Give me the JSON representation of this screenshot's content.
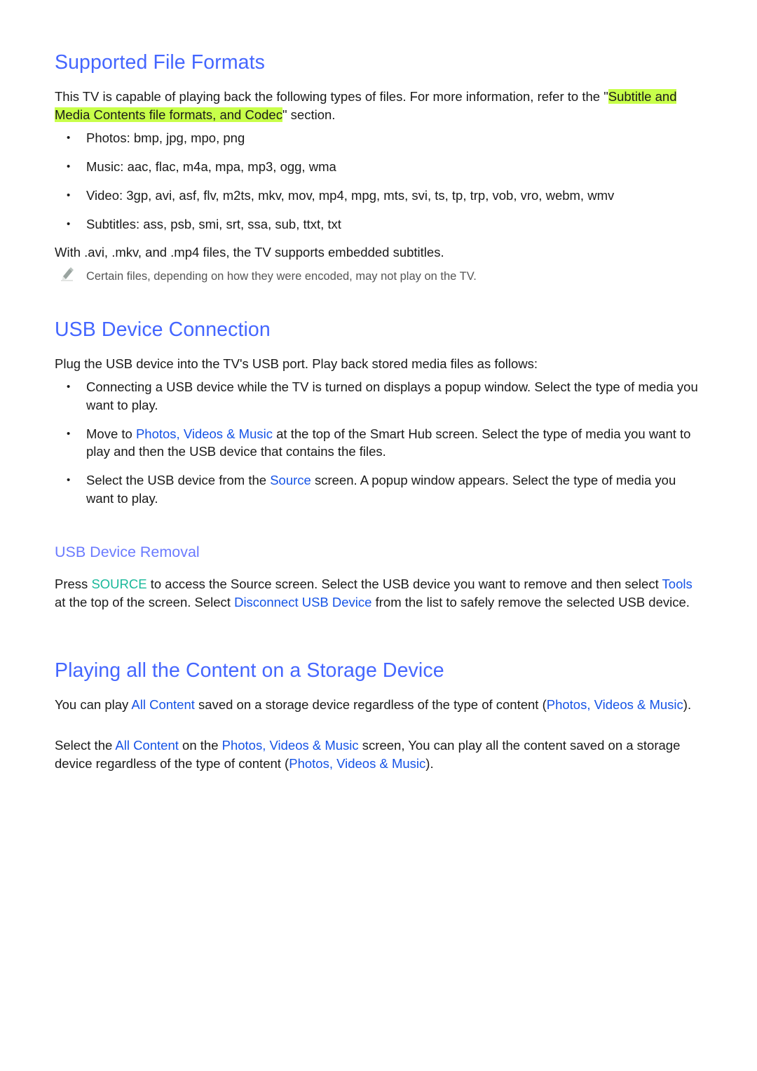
{
  "section1": {
    "title": "Supported File Formats",
    "intro_before": "This TV is capable of playing back the following types of files. For more information, refer to the \"",
    "intro_highlight": "Subtitle and Media Contents file formats, and Codec",
    "intro_after": "\" section.",
    "bullets": [
      "Photos: bmp, jpg, mpo, png",
      "Music: aac, flac, m4a, mpa, mp3, ogg, wma",
      "Video: 3gp, avi, asf, flv, m2ts, mkv, mov, mp4, mpg, mts, svi, ts, tp, trp, vob, vro, webm, wmv",
      "Subtitles: ass, psb, smi, srt, ssa, sub, ttxt, txt"
    ],
    "embedded": "With .avi, .mkv, and .mp4 files, the TV supports embedded subtitles.",
    "note_icon": "pencil-icon",
    "note": "Certain files, depending on how they were encoded, may not play on the TV."
  },
  "section2": {
    "title": "USB Device Connection",
    "intro": "Plug the USB device into the TV's USB port. Play back stored media files as follows:",
    "bullet1": "Connecting a USB device while the TV is turned on displays a popup window. Select the type of media you want to play.",
    "bullet2_before": "Move to ",
    "bullet2_link": "Photos, Videos & Music",
    "bullet2_after": " at the top of the Smart Hub screen. Select the type of media you want to play and then the USB device that contains the files.",
    "bullet3_before": "Select the USB device from the ",
    "bullet3_link": "Source",
    "bullet3_after": " screen. A popup window appears. Select the type of media you want to play."
  },
  "subsection": {
    "title": "USB Device Removal",
    "t1": "Press ",
    "source_key": "SOURCE",
    "t2": " to access the Source screen. Select the USB device you want to remove and then select ",
    "tools_link": "Tools",
    "t3": " at the top of the screen. Select ",
    "disconnect_link": "Disconnect USB Device",
    "t4": " from the list to safely remove the selected USB device."
  },
  "section3": {
    "title": "Playing all the Content on a Storage Device",
    "p1_t1": "You can play ",
    "p1_link1": "All Content",
    "p1_t2": " saved on a storage device regardless of the type of content (",
    "p1_link2": "Photos, Videos & Music",
    "p1_t3": ").",
    "p2_t1": "Select the ",
    "p2_link1": "All Content",
    "p2_t2": " on the ",
    "p2_link2": "Photos, Videos & Music",
    "p2_t3": " screen, You can play all the content saved on a storage device regardless of the type of content (",
    "p2_link3": "Photos, Videos & Music",
    "p2_t4": ")."
  },
  "colors": {
    "heading": "#4466ff",
    "subheading": "#6b7bff",
    "link": "#1553e6",
    "source_key": "#18b89a",
    "highlight": "#c8ff4a",
    "body_text": "#1a1a1a",
    "note_text": "#555555"
  }
}
